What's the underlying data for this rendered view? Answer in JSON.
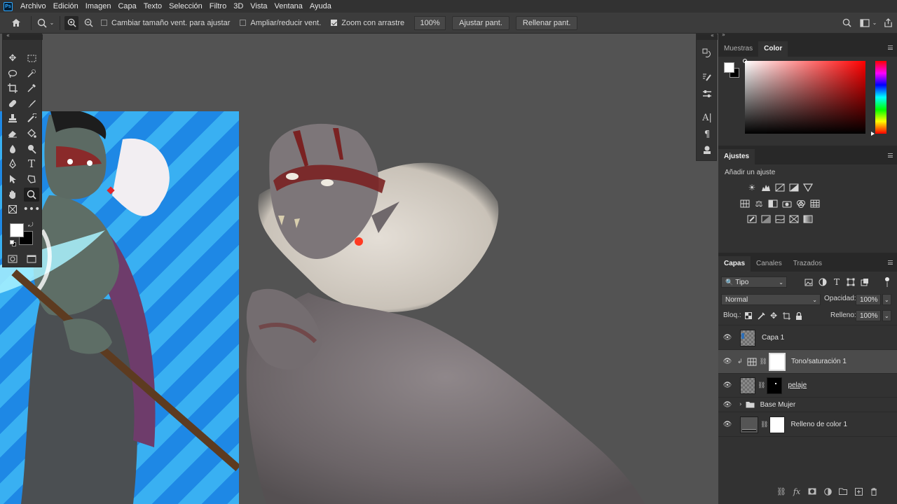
{
  "app": {
    "logo": "Ps"
  },
  "menu": [
    "Archivo",
    "Edición",
    "Imagen",
    "Capa",
    "Texto",
    "Selección",
    "Filtro",
    "3D",
    "Vista",
    "Ventana",
    "Ayuda"
  ],
  "options": {
    "resize_window": "Cambiar tamaño vent. para ajustar",
    "zoom_all": "Ampliar/reducir vent.",
    "scrubby_zoom": "Zoom con arrastre",
    "zoom_value": "100%",
    "fit_screen": "Ajustar pant.",
    "fill_screen": "Rellenar pant."
  },
  "panels": {
    "swatches_tab": "Muestras",
    "color_tab": "Color",
    "adjustments_tab": "Ajustes",
    "add_adjustment": "Añadir un ajuste",
    "layers_tab": "Capas",
    "channels_tab": "Canales",
    "paths_tab": "Trazados"
  },
  "layers_panel": {
    "filter_kind": "Tipo",
    "blend_mode": "Normal",
    "opacity_label": "Opacidad:",
    "opacity_value": "100%",
    "lock_label": "Bloq.:",
    "fill_label": "Relleno:",
    "fill_value": "100%",
    "layers": [
      {
        "name": "Capa 1"
      },
      {
        "name": "Tono/saturación 1"
      },
      {
        "name": "pelaje"
      },
      {
        "name": "Base Mujer"
      },
      {
        "name": "Relleno de color 1"
      }
    ]
  },
  "colors": {
    "foreground": "#ffffff",
    "background": "#000000",
    "hue_selected": "#ff0000"
  }
}
